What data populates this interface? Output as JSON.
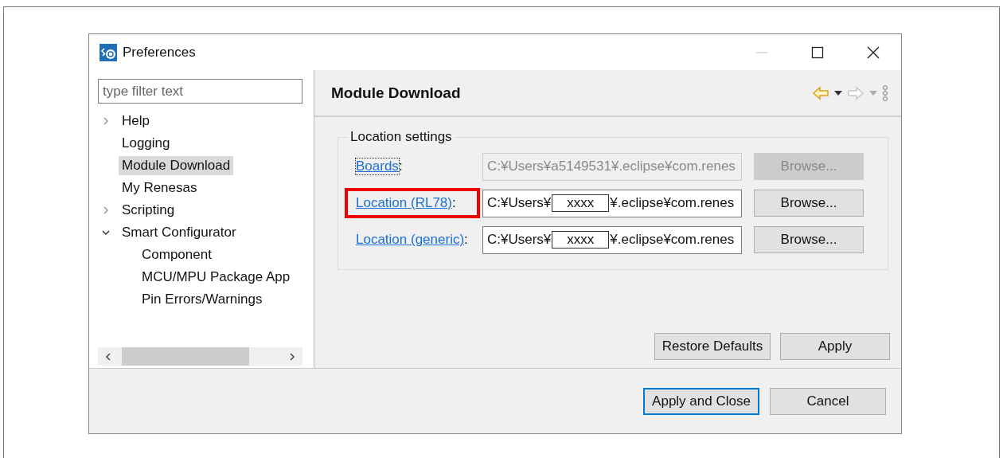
{
  "window": {
    "title": "Preferences"
  },
  "sidebar": {
    "filter": {
      "placeholder": "type filter text"
    },
    "tree": [
      {
        "label": "Help",
        "expanded": false,
        "selected": false
      },
      {
        "label": "Logging",
        "selected": false
      },
      {
        "label": "Module Download",
        "selected": true
      },
      {
        "label": "My Renesas",
        "selected": false
      },
      {
        "label": "Scripting",
        "expanded": false,
        "selected": false
      },
      {
        "label": "Smart Configurator",
        "expanded": true,
        "selected": false,
        "children": [
          {
            "label": "Component",
            "selected": false
          },
          {
            "label": "MCU/MPU Package App",
            "selected": false
          },
          {
            "label": "Pin Errors/Warnings",
            "selected": false
          }
        ]
      }
    ]
  },
  "page": {
    "title": "Module Download",
    "nav": {
      "back_disabled": false,
      "forward_disabled": true
    },
    "group": {
      "title": "Location settings",
      "rows": [
        {
          "label": "Boards",
          "colon": ":",
          "focused": true,
          "highlighted": false,
          "disabled": true,
          "segments": [
            {
              "kind": "plain",
              "text": "C:¥Users¥a5149531¥.eclipse¥com.renes"
            }
          ],
          "button": "Browse..."
        },
        {
          "label": "Location (RL78)",
          "colon": ":",
          "focused": false,
          "highlighted": true,
          "disabled": false,
          "segments": [
            {
              "kind": "plain",
              "text": "C:¥Users¥"
            },
            {
              "kind": "mask",
              "text": "xxxx"
            },
            {
              "kind": "plain",
              "text": "¥.eclipse¥com.renes"
            }
          ],
          "button": "Browse..."
        },
        {
          "label": "Location (generic)",
          "colon": ":",
          "focused": false,
          "highlighted": false,
          "disabled": false,
          "segments": [
            {
              "kind": "plain",
              "text": "C:¥Users¥"
            },
            {
              "kind": "mask",
              "text": "xxxx"
            },
            {
              "kind": "plain",
              "text": "¥.eclipse¥com.renes"
            }
          ],
          "button": "Browse..."
        }
      ]
    },
    "buttons": [
      {
        "label": "Restore Defaults"
      },
      {
        "label": "Apply"
      }
    ]
  },
  "footer": {
    "buttons": [
      {
        "label": "Apply and Close",
        "default": true
      },
      {
        "label": "Cancel",
        "default": false
      }
    ]
  }
}
